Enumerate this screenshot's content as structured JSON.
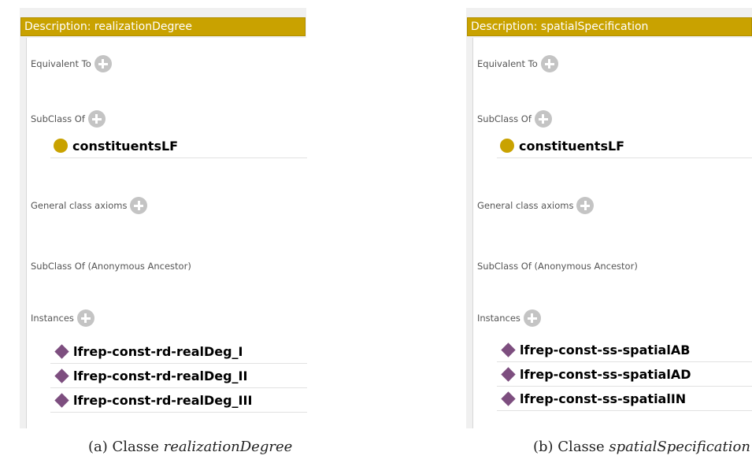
{
  "panels": [
    {
      "title": "Description: realizationDegree",
      "equivalent_to_label": "Equivalent To",
      "subclass_of_label": "SubClass Of",
      "superclass": "constituentsLF",
      "general_axioms_label": "General class axioms",
      "anonymous_ancestor_label": "SubClass Of (Anonymous Ancestor)",
      "instances_label": "Instances",
      "instances": [
        "lfrep-const-rd-realDeg_I",
        "lfrep-const-rd-realDeg_II",
        "lfrep-const-rd-realDeg_III"
      ],
      "caption_prefix": "(a) Classe ",
      "caption_name": "realizationDegree"
    },
    {
      "title": "Description: spatialSpecification",
      "equivalent_to_label": "Equivalent To",
      "subclass_of_label": "SubClass Of",
      "superclass": "constituentsLF",
      "general_axioms_label": "General class axioms",
      "anonymous_ancestor_label": "SubClass Of (Anonymous Ancestor)",
      "instances_label": "Instances",
      "instances": [
        "lfrep-const-ss-spatialAB",
        "lfrep-const-ss-spatialAD",
        "lfrep-const-ss-spatialIN"
      ],
      "caption_prefix": "(b) Classe ",
      "caption_name": "spatialSpecification"
    }
  ],
  "icons": {
    "add": "plus-circle-icon",
    "class": "class-circle-icon",
    "instance": "instance-diamond-icon"
  },
  "colors": {
    "title_bar": "#c9a200",
    "class_dot": "#c9a200",
    "instance_diamond": "#7d4e7f",
    "add_button": "#c4c4c4"
  }
}
